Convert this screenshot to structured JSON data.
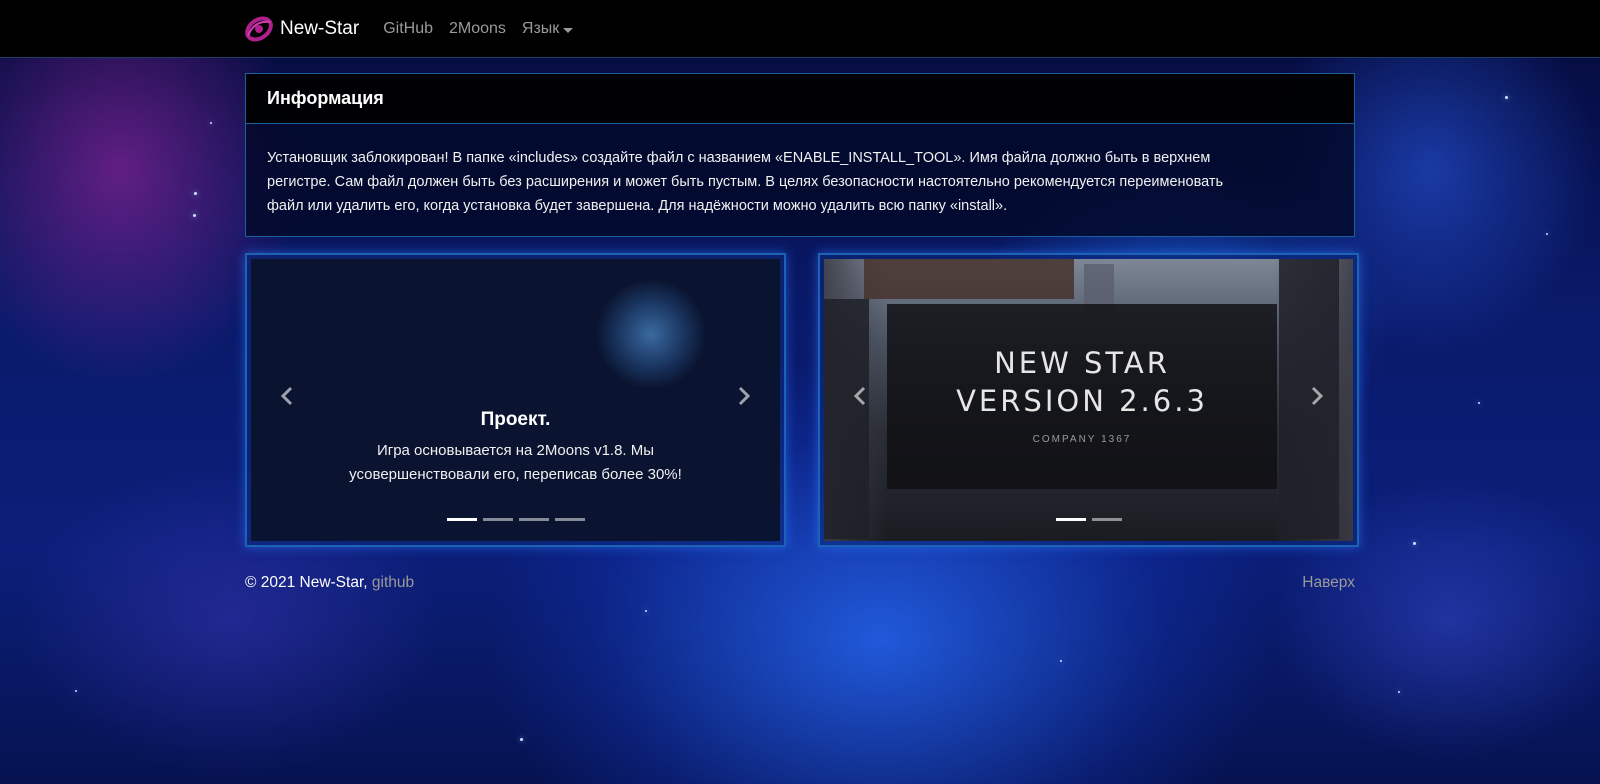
{
  "navbar": {
    "brand": "New-Star",
    "brand_icon": "galaxy-logo-icon",
    "links": [
      "GitHub",
      "2Moons"
    ],
    "language_label": "Язык"
  },
  "info": {
    "title": "Информация",
    "line1": "Установщик заблокирован! В папке «includes» создайте файл с названием «ENABLE_INSTALL_TOOL». Имя файла должно быть в верхнем",
    "line2": "регистре. Сам файл должен быть без расширения и может быть пустым. В целях безопасности настоятельно рекомендуется переименовать",
    "line3": "файл или удалить его, когда установка будет завершена. Для надёжности можно удалить всю папку «install»."
  },
  "carousel1": {
    "caption_title": "Проект.",
    "caption_line1": "Игра основывается на 2Moons v1.8. Мы",
    "caption_line2": "усовершенствовали его, переписав более 30%!",
    "indicator_count": 4,
    "active_index": 0
  },
  "carousel2": {
    "title_line1": "NEW STAR",
    "title_line2": "VERSION 2.6.3",
    "company": "COMPANY 1367",
    "indicator_count": 2,
    "active_index": 0
  },
  "footer": {
    "copyright": "© 2021 New-Star,",
    "github_link": "github",
    "top_link": "Наверх"
  },
  "colors": {
    "accent_border": "#1e62b8",
    "navbar_bg": "#000000",
    "link_gray": "#9a9a9a"
  }
}
